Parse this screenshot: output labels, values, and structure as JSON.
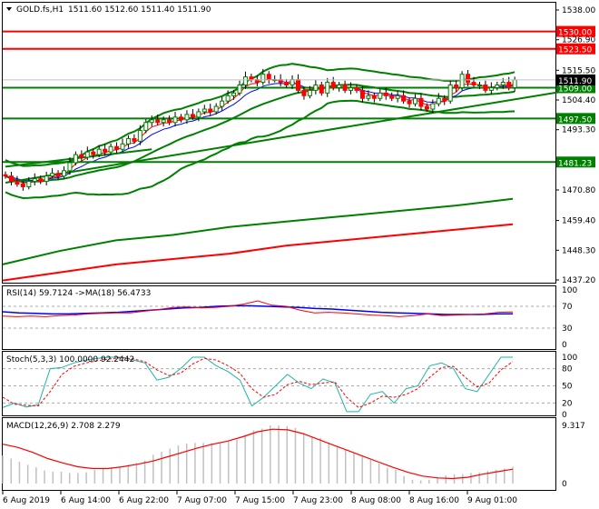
{
  "header": {
    "symbol": "GOLD.fs,H1",
    "ohlc": "1511.60 1512.60 1511.40 1511.90"
  },
  "colors": {
    "bull": "#008000",
    "bear": "#ff0000",
    "green_line": "#008000",
    "red_line": "#ff0000",
    "ma_blue": "#0000ff",
    "stoch_main": "#20b2aa",
    "hist": "#c0c0c0"
  },
  "chart_data": [
    {
      "type": "candlestick",
      "title": "GOLD.fs,H1",
      "ylim": [
        1437.2,
        1538.0
      ],
      "yticks": [
        "1538.00",
        "1526.90",
        "1515.50",
        "1504.40",
        "1493.30",
        "1470.80",
        "1459.40",
        "1448.30",
        "1437.20"
      ],
      "current_price": "1511.90",
      "levels": [
        {
          "value": 1530.0,
          "label": "1530.00",
          "color": "red"
        },
        {
          "value": 1523.5,
          "label": "1523.50",
          "color": "red"
        },
        {
          "value": 1509.0,
          "label": "1509.00",
          "color": "green"
        },
        {
          "value": 1497.5,
          "label": "1497.50",
          "color": "green"
        },
        {
          "value": 1481.23,
          "label": "1481.23",
          "color": "green"
        }
      ],
      "trendlines": [
        {
          "from": [
            0,
            1473.5
          ],
          "to": [
            95,
            1507.5
          ]
        },
        {
          "from": [
            0,
            1479.5
          ],
          "to": [
            25,
            1486
          ]
        }
      ],
      "closes": [
        1476,
        1474,
        1473,
        1472,
        1474,
        1475,
        1474,
        1476,
        1477,
        1476,
        1478,
        1481,
        1484,
        1483,
        1485,
        1484,
        1486,
        1485,
        1487,
        1486,
        1488,
        1490,
        1489,
        1493,
        1496,
        1497,
        1496,
        1497,
        1496,
        1498,
        1497,
        1499,
        1498,
        1500,
        1501,
        1500,
        1502,
        1504,
        1506,
        1507,
        1510,
        1513,
        1512,
        1511,
        1514,
        1512,
        1512,
        1511,
        1510,
        1512,
        1508,
        1506,
        1508,
        1510,
        1507,
        1511,
        1509,
        1510,
        1508,
        1509,
        1508,
        1505,
        1506,
        1505,
        1507,
        1506,
        1505,
        1506,
        1504,
        1503,
        1505,
        1502,
        1501,
        1503,
        1505,
        1504,
        1510,
        1509,
        1514,
        1511,
        1510,
        1510,
        1508,
        1509,
        1510,
        1511,
        1509,
        1511.9
      ],
      "slow_ma_green": [
        1443,
        1448,
        1452,
        1454,
        1457,
        1459,
        1461,
        1463,
        1465,
        1467.5
      ],
      "slow_ma_red": [
        1437,
        1440,
        1443,
        1445,
        1447,
        1450,
        1452,
        1454,
        1456,
        1458
      ]
    },
    {
      "type": "line",
      "title": "RSI(14) 59.7124  ->MA(18) 56.4733",
      "ylim": [
        0,
        100
      ],
      "yticks": [
        "100",
        "70",
        "30",
        "0"
      ],
      "levels": [
        70,
        30
      ],
      "rsi": [
        52,
        51,
        52,
        51,
        53,
        54,
        56,
        57,
        58,
        58,
        61,
        64,
        68,
        69,
        67,
        68,
        70,
        74,
        80,
        72,
        70,
        63,
        58,
        59,
        58,
        56,
        54,
        53,
        51,
        53,
        56,
        53,
        54,
        55,
        56,
        59,
        59.7
      ],
      "ma": [
        60,
        58,
        57,
        56,
        56,
        57,
        58,
        59,
        61,
        63,
        65,
        67,
        68,
        70,
        71,
        71,
        70,
        69,
        68,
        66,
        65,
        63,
        61,
        59,
        58,
        57,
        56,
        55,
        55,
        55,
        56,
        56.4
      ]
    },
    {
      "type": "line",
      "title": "Stoch(5,3,3) 100.0000 92.2442",
      "ylim": [
        0,
        100
      ],
      "yticks": [
        "100",
        "80",
        "50",
        "20",
        "0"
      ],
      "levels": [
        80,
        50,
        20
      ],
      "main": [
        12,
        20,
        13,
        17,
        80,
        82,
        90,
        95,
        98,
        100,
        100,
        95,
        90,
        60,
        65,
        80,
        100,
        100,
        85,
        75,
        60,
        15,
        30,
        50,
        70,
        55,
        45,
        62,
        55,
        5,
        5,
        35,
        40,
        20,
        45,
        50,
        85,
        90,
        80,
        45,
        40,
        70,
        100,
        100
      ],
      "signal": [
        30,
        18,
        16,
        15,
        40,
        70,
        84,
        90,
        94,
        97,
        99,
        97,
        92,
        78,
        68,
        72,
        88,
        98,
        95,
        85,
        72,
        45,
        30,
        35,
        52,
        58,
        52,
        55,
        57,
        30,
        12,
        20,
        32,
        30,
        35,
        45,
        65,
        82,
        84,
        65,
        48,
        55,
        78,
        92.2
      ]
    },
    {
      "type": "bar+line",
      "title": "MACD(12,26,9) 2.708 2.279",
      "ylim": [
        0,
        9.317
      ],
      "yticks": [
        "9.317",
        "0"
      ],
      "histogram": [
        4.5,
        4,
        3.5,
        3.0,
        2.6,
        2.1,
        1.9,
        1.9,
        1.7,
        1.7,
        1.8,
        2.2,
        2.5,
        2.6,
        2.7,
        3.0,
        3.3,
        3.7,
        4.6,
        5.1,
        5.6,
        6.1,
        6.4,
        6.5,
        6.5,
        6.5,
        6.6,
        6.7,
        7.0,
        7.7,
        8.5,
        8.8,
        9.3,
        9.3,
        9.2,
        8.9,
        8.1,
        7.4,
        7.3,
        6.5,
        6.0,
        5.4,
        4.9,
        4.4,
        3.8,
        3.2,
        2.5,
        2.2,
        1.2,
        0.6,
        0.5,
        0.6,
        1.0,
        1.3,
        1.5,
        1.5,
        1.7,
        1.8,
        2.0,
        2.2,
        2.4,
        2.7
      ],
      "signal": [
        6.3,
        5.8,
        5.0,
        4.0,
        3.3,
        2.7,
        2.4,
        2.4,
        2.7,
        3.1,
        3.6,
        4.3,
        5.0,
        5.7,
        6.3,
        6.8,
        7.5,
        8.3,
        8.7,
        8.6,
        8.0,
        7.1,
        6.2,
        5.3,
        4.4,
        3.5,
        2.6,
        1.8,
        1.2,
        0.9,
        0.8,
        1.0,
        1.5,
        1.9,
        2.3
      ]
    }
  ],
  "xaxis": {
    "labels": [
      "6 Aug 2019",
      "6 Aug 14:00",
      "6 Aug 22:00",
      "7 Aug 07:00",
      "7 Aug 15:00",
      "7 Aug 23:00",
      "8 Aug 08:00",
      "8 Aug 16:00",
      "9 Aug 01:00"
    ]
  }
}
